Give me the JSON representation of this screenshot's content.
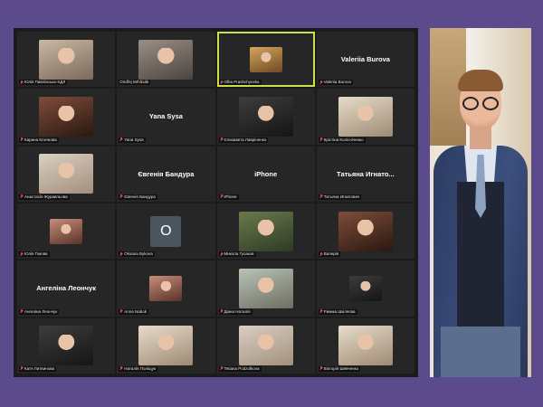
{
  "participants": [
    {
      "caption": "Юлія Павлівська-ХДЛ",
      "video": true,
      "video_style": "v1",
      "muted": true
    },
    {
      "caption": "Ondřej Mrhůsák",
      "video": true,
      "video_style": "v2",
      "muted": false
    },
    {
      "caption": "Olha Prashchynska",
      "video": true,
      "video_style": "v7",
      "size": "small",
      "active": true,
      "muted": true
    },
    {
      "caption": "Valeriia Burova",
      "display_name": "Valeriia Burova",
      "muted": true
    },
    {
      "caption": "Карина Клочкова",
      "video": true,
      "video_style": "v5",
      "muted": true
    },
    {
      "caption": "Yana Sysa",
      "display_name": "Yana Sysa",
      "muted": true
    },
    {
      "caption": "Єлизавета Лавріненко",
      "video": true,
      "video_style": "v8",
      "muted": true
    },
    {
      "caption": "Крістіна Колісніченко",
      "video": true,
      "video_style": "v9",
      "muted": true
    },
    {
      "caption": "Анастасія Журавльова",
      "video": true,
      "video_style": "v3",
      "muted": true
    },
    {
      "caption": "Євгенія Бандура",
      "display_name": "Євгенія Бандура",
      "muted": true
    },
    {
      "caption": "iPhone",
      "display_name": "iPhone",
      "muted": true
    },
    {
      "caption": "Татьяна Игнатович",
      "display_name": "Татьяна  Игнато...",
      "muted": true
    },
    {
      "caption": "Юлія Гімова",
      "video": true,
      "video_style": "v10",
      "size": "small",
      "muted": true
    },
    {
      "caption": "Oksana Bykova",
      "avatar_letter": "O",
      "muted": true
    },
    {
      "caption": "Микола Гусаков",
      "video": true,
      "video_style": "v4",
      "muted": true
    },
    {
      "caption": "Валерія",
      "video": true,
      "video_style": "v5",
      "muted": true
    },
    {
      "caption": "Ангеліна Леончук",
      "display_name": "Ангеліна Леончук",
      "muted": true
    },
    {
      "caption": "Anna Nabok",
      "video": true,
      "video_style": "v10",
      "size": "small",
      "muted": true
    },
    {
      "caption": "Діана Наталія",
      "video": true,
      "video_style": "v6",
      "muted": true
    },
    {
      "caption": "Римма Шкіляєва",
      "video": true,
      "video_style": "v8",
      "size": "small",
      "muted": true
    },
    {
      "caption": "Катя Литвинова",
      "video": true,
      "video_style": "v8",
      "muted": true
    },
    {
      "caption": "Наталія Поліщук",
      "video": true,
      "video_style": "v9",
      "muted": true
    },
    {
      "caption": "Tetiana Podzolkova",
      "video": true,
      "video_style": "v3",
      "muted": true
    },
    {
      "caption": "Вікторія Шевченко",
      "video": true,
      "video_style": "v9",
      "muted": true
    }
  ],
  "colors": {
    "background": "#5b4a8c",
    "panel": "#1b1b1b",
    "tile": "#262626",
    "active_border": "#c8e04a",
    "muted_icon": "#e04848"
  },
  "icons": {
    "muted": "mic-muted-icon"
  }
}
